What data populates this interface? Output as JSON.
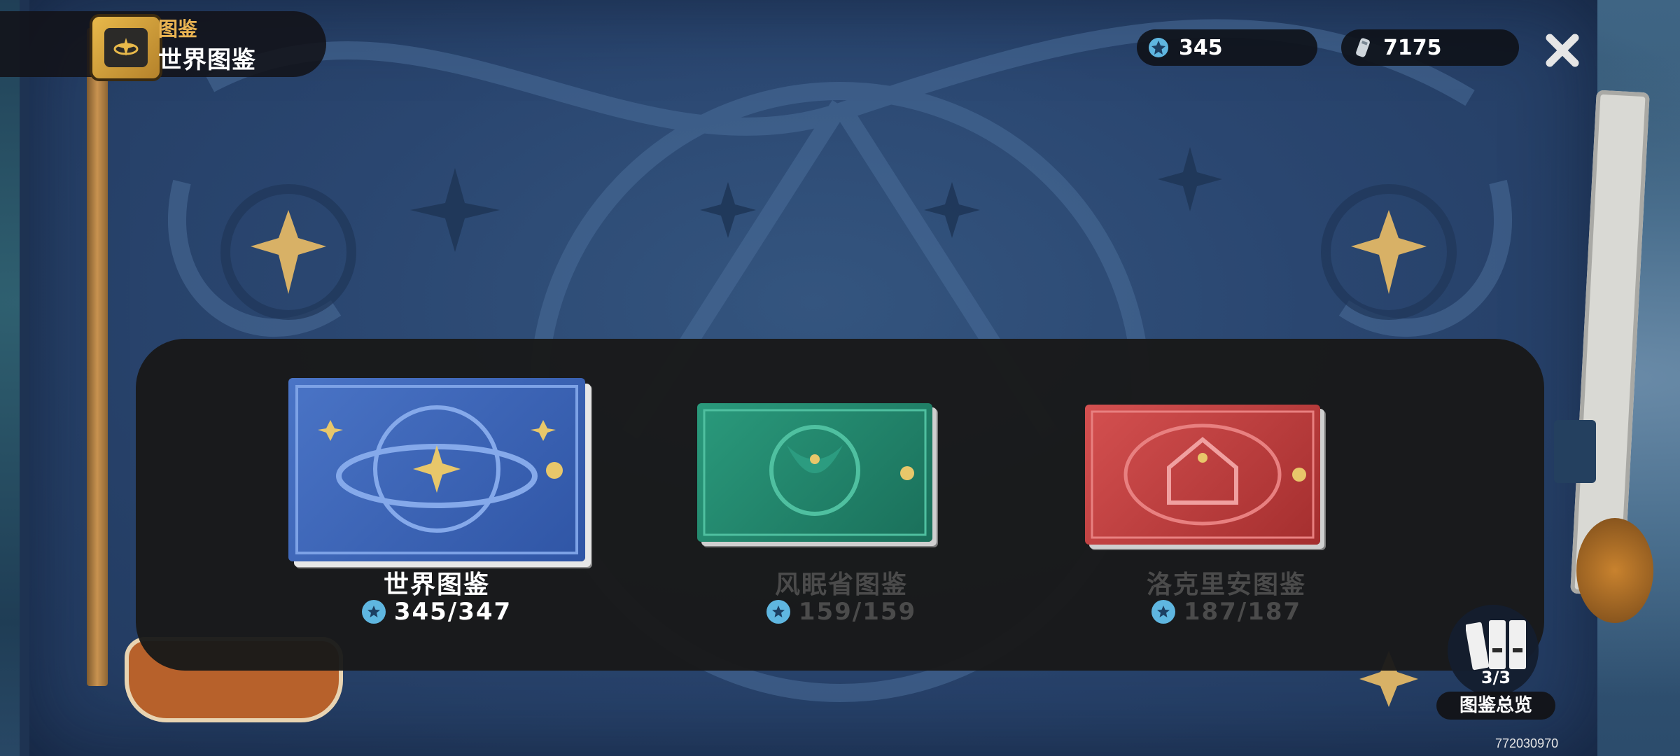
{
  "header": {
    "category": "图鉴",
    "title": "世界图鉴"
  },
  "currency": {
    "stars": "345",
    "coins": "7175"
  },
  "books": [
    {
      "name": "世界图鉴",
      "progress": "345/347",
      "state": "selected",
      "color": "#3a5fb0"
    },
    {
      "name": "风眠省图鉴",
      "progress": "159/159",
      "state": "normal",
      "color": "#1d7a63"
    },
    {
      "name": "洛克里安图鉴",
      "progress": "187/187",
      "state": "normal",
      "color": "#b83a3a"
    }
  ],
  "overview": {
    "fraction": "3/3",
    "label": "图鉴总览"
  },
  "uid": "772030970",
  "colors": {
    "accent_gold": "#e9b352",
    "panel": "#191919",
    "cover": "#2a4670"
  }
}
